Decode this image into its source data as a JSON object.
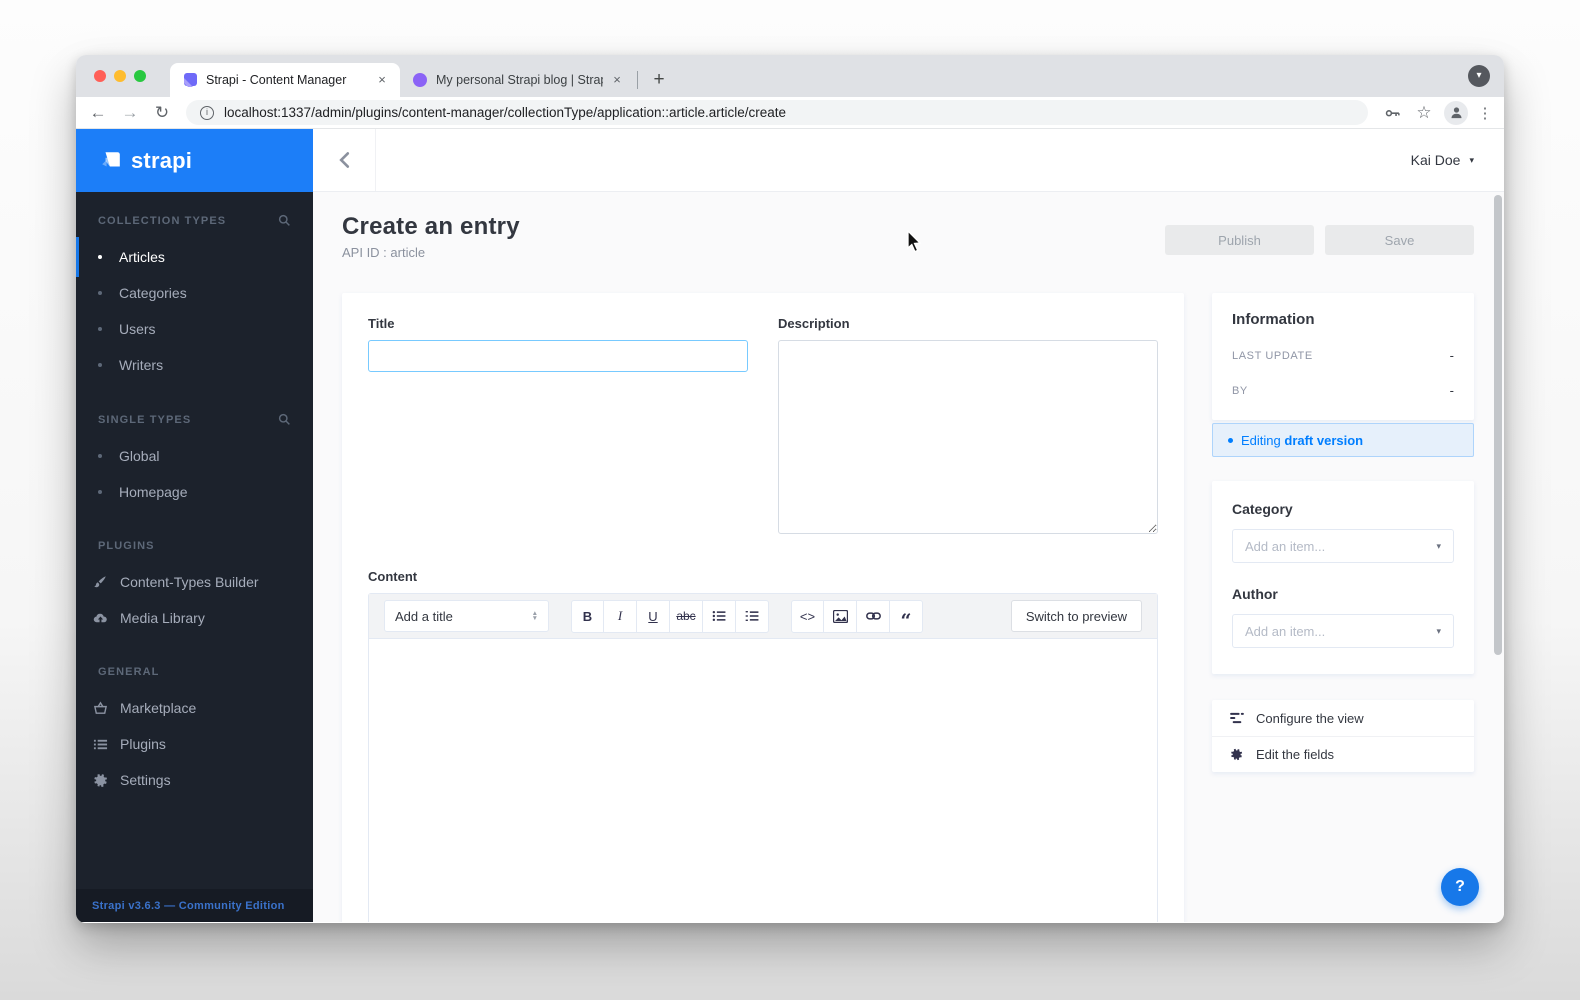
{
  "browser": {
    "tab1": "Strapi - Content Manager",
    "tab2": "My personal Strapi blog | Strap",
    "close": "×",
    "new_tab": "+",
    "tab_search": "▾",
    "url": "localhost:1337/admin/plugins/content-manager/collectionType/application::article.article/create",
    "info_glyph": "i",
    "back": "←",
    "forward": "→",
    "reload": "↻",
    "star": "☆",
    "menu_dots": "⋮"
  },
  "sidebar": {
    "logo_text": "strapi",
    "collection_types_heading": "COLLECTION TYPES",
    "items_ct": [
      "Articles",
      "Categories",
      "Users",
      "Writers"
    ],
    "single_types_heading": "SINGLE TYPES",
    "items_st": [
      "Global",
      "Homepage"
    ],
    "plugins_heading": "PLUGINS",
    "items_plugins": [
      "Content-Types Builder",
      "Media Library"
    ],
    "general_heading": "GENERAL",
    "items_general": [
      "Marketplace",
      "Plugins",
      "Settings"
    ],
    "footer": "Strapi v3.6.3 — Community Edition"
  },
  "topbar": {
    "user": "Kai Doe",
    "back_chevron": "‹",
    "caret": "▾"
  },
  "page": {
    "title": "Create an entry",
    "api_id": "API ID : article",
    "publish": "Publish",
    "save": "Save"
  },
  "form": {
    "title_label": "Title",
    "description_label": "Description",
    "content_label": "Content",
    "editor": {
      "title_placeholder": "Add a title",
      "bold": "B",
      "italic": "I",
      "underline": "U",
      "strike": "abc",
      "code": "<>",
      "quote": "“",
      "switch_preview": "Switch to preview"
    }
  },
  "panel": {
    "information": {
      "heading": "Information",
      "last_update_label": "LAST UPDATE",
      "last_update_value": "-",
      "by_label": "BY",
      "by_value": "-"
    },
    "banner": {
      "text": "Editing",
      "bold": "draft version"
    },
    "relations": {
      "category_label": "Category",
      "author_label": "Author",
      "add_item_placeholder": "Add an item...",
      "caret": "▾"
    },
    "links": {
      "configure_view": "Configure the view",
      "edit_fields": "Edit the fields"
    }
  },
  "help_label": "?",
  "colors": {
    "accent": "#007eff",
    "strapi_blue": "#1c7ef8",
    "active_bar": "#1778e9",
    "banner_bg": "#e6f0fb"
  }
}
